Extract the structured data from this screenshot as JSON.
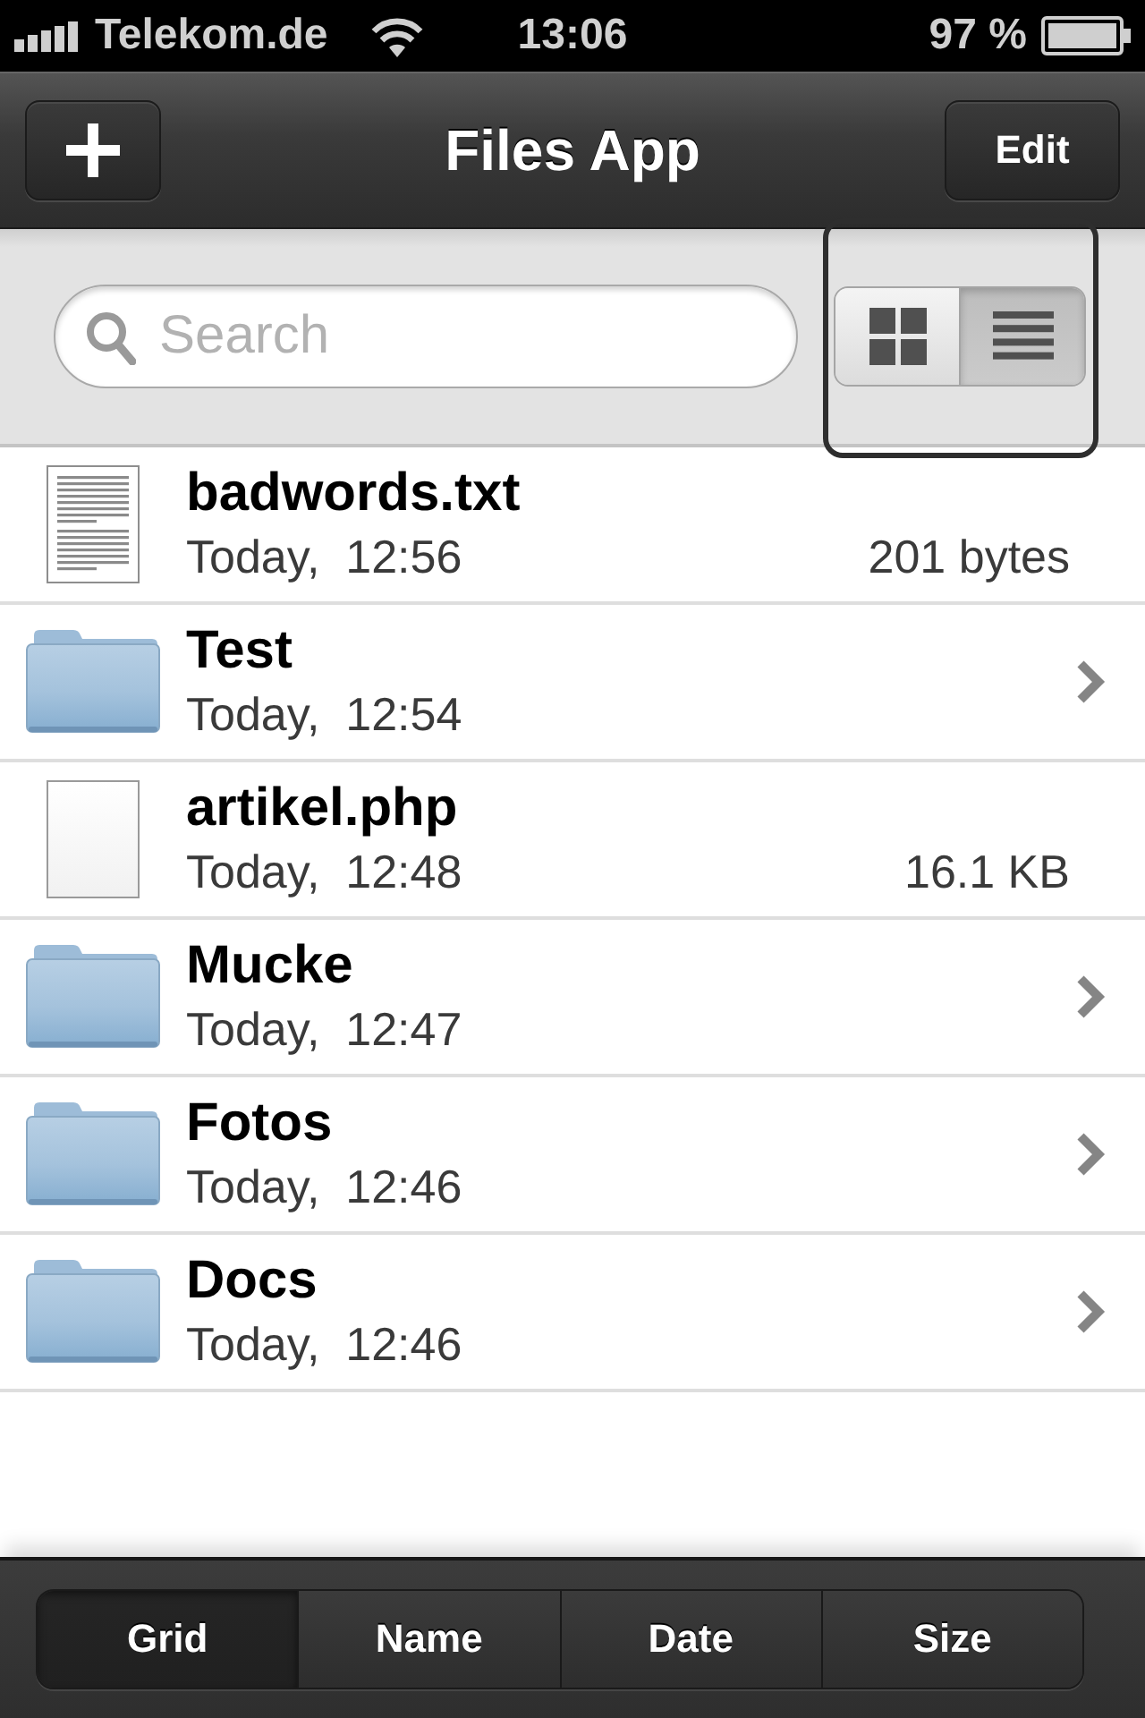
{
  "status_bar": {
    "carrier": "Telekom.de",
    "time": "13:06",
    "battery": "97 %"
  },
  "nav_bar": {
    "title": "Files App",
    "edit_button": "Edit"
  },
  "search": {
    "placeholder": "Search"
  },
  "view_toggle": [
    {
      "kind": "grid",
      "selected": false
    },
    {
      "kind": "list",
      "selected": true
    }
  ],
  "files": [
    {
      "kind": "text_file",
      "name": "badwords.txt",
      "modified": "Today,  12:56",
      "size": "201 bytes"
    },
    {
      "kind": "folder",
      "name": "Test",
      "modified": "Today,  12:54"
    },
    {
      "kind": "blank_file",
      "name": "artikel.php",
      "modified": "Today,  12:48",
      "size": "16.1 KB"
    },
    {
      "kind": "folder",
      "name": "Mucke",
      "modified": "Today,  12:47"
    },
    {
      "kind": "folder",
      "name": "Fotos",
      "modified": "Today,  12:46"
    },
    {
      "kind": "folder",
      "name": "Docs",
      "modified": "Today,  12:46"
    }
  ],
  "sort_tabs": [
    {
      "label": "Grid",
      "selected": true
    },
    {
      "label": "Name",
      "selected": false
    },
    {
      "label": "Date",
      "selected": false
    },
    {
      "label": "Size",
      "selected": false
    }
  ]
}
